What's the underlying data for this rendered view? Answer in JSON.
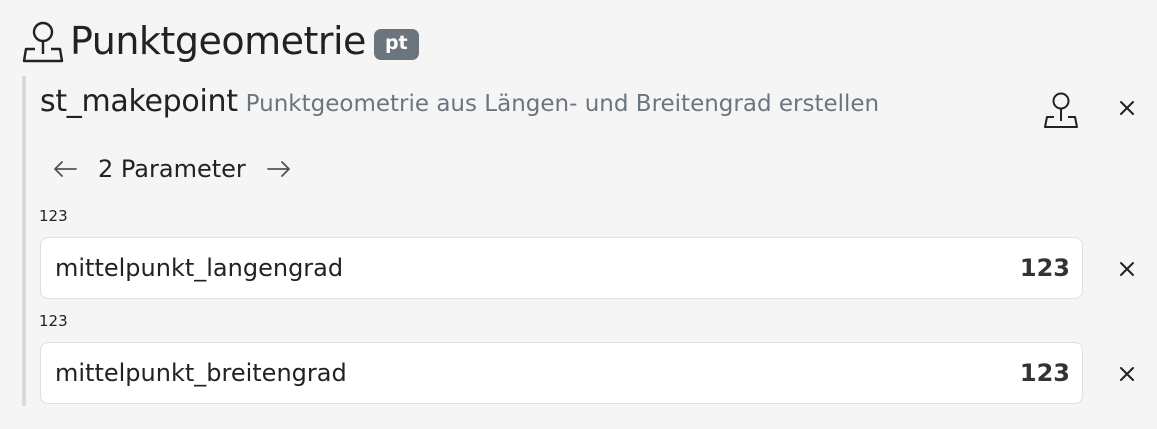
{
  "header": {
    "title": "Punktgeometrie",
    "badge": "pt",
    "icon": "map-pin-icon"
  },
  "function": {
    "name": "st_makepoint",
    "description": "Punktgeometrie aus Längen- und Breitengrad erstellen",
    "icon": "map-pin-icon",
    "close_icon": "close-icon"
  },
  "params_nav": {
    "label": "2 Parameter",
    "prev_icon": "arrow-left-icon",
    "next_icon": "arrow-right-icon"
  },
  "params": [
    {
      "type_label": "123",
      "value": "mittelpunkt_langengrad",
      "type_badge": "123"
    },
    {
      "type_label": "123",
      "value": "mittelpunkt_breitengrad",
      "type_badge": "123"
    }
  ],
  "colors": {
    "background": "#f5f5f6",
    "badge": "#6c757d",
    "muted_text": "#6c757d",
    "border": "#dcdfe3"
  }
}
